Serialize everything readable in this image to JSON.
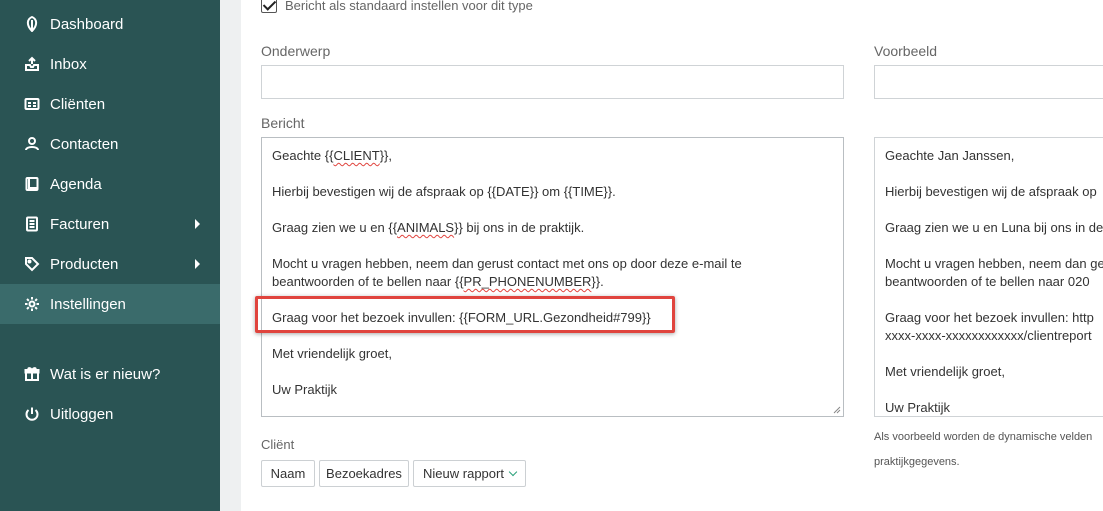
{
  "sidebar": {
    "items": [
      {
        "label": "Dashboard",
        "icon": "leaf-icon"
      },
      {
        "label": "Inbox",
        "icon": "inbox-icon"
      },
      {
        "label": "Cliënten",
        "icon": "id-card-icon"
      },
      {
        "label": "Contacten",
        "icon": "contacts-icon"
      },
      {
        "label": "Agenda",
        "icon": "calendar-icon"
      },
      {
        "label": "Facturen",
        "icon": "invoice-icon"
      },
      {
        "label": "Producten",
        "icon": "tag-icon"
      },
      {
        "label": "Instellingen",
        "icon": "gear-icon"
      }
    ],
    "whats_new": "Wat is er nieuw?",
    "logout": "Uitloggen"
  },
  "form": {
    "default_checkbox_label": "Bericht als standaard instellen voor dit type",
    "default_checked": true,
    "subject_label": "Onderwerp",
    "subject_value": "",
    "preview_label": "Voorbeeld",
    "message_label": "Bericht",
    "message": {
      "greeting_pre": "Geachte {{",
      "greeting_var": "CLIENT",
      "greeting_post": "}},",
      "line2": "Hierbij bevestigen wij de afspraak op {{DATE}} om {{TIME}}.",
      "line3_pre": "Graag zien we u en {{",
      "line3_var": "ANIMALS",
      "line3_post": "}} bij ons in de praktijk.",
      "line4a": "Mocht u vragen hebben, neem dan gerust contact met ons op door deze e-mail te",
      "line4b_pre": "beantwoorden of te bellen naar {{",
      "line4b_var": "PR_PHONENUMBER",
      "line4b_post": "}}.",
      "line5": "Graag voor het bezoek invullen: {{FORM_URL.Gezondheid#799}}",
      "line6": "Met vriendelijk groet,",
      "line7": "Uw Praktijk"
    },
    "preview": {
      "line1": "Geachte Jan Janssen,",
      "line2": "Hierbij bevestigen wij de afspraak op",
      "line3": "Graag zien we u en Luna bij ons in de",
      "line4a": "Mocht u vragen hebben, neem dan ge",
      "line4b": "beantwoorden of te bellen naar 020",
      "line5a": "Graag voor het bezoek invullen: http",
      "line5b": "xxxx-xxxx-xxxxxxxxxxxx/clientreport",
      "line6": "Met vriendelijk groet,",
      "line7": "Uw Praktijk"
    },
    "preview_note_line1": "Als voorbeeld worden de dynamische velden",
    "preview_note_line2": "praktijkgegevens.",
    "client_label": "Cliënt",
    "client_buttons": {
      "naam": "Naam",
      "bezoekadres": "Bezoekadres",
      "nieuw_rapport": "Nieuw rapport"
    }
  }
}
